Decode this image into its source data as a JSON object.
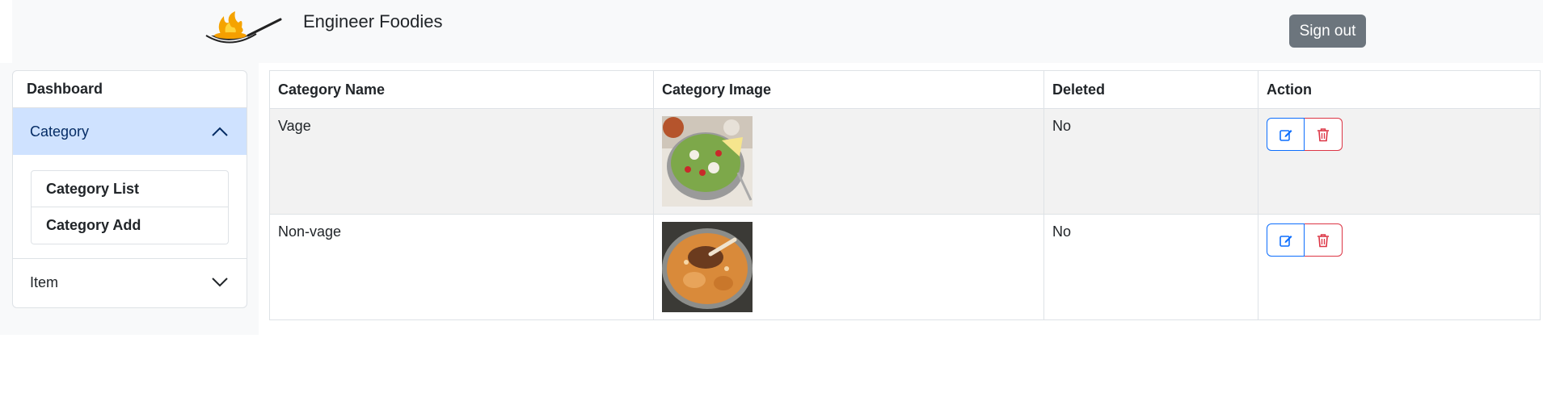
{
  "header": {
    "brand_name": "Engineer Foodies",
    "signout_label": "Sign out"
  },
  "sidebar": {
    "dashboard_label": "Dashboard",
    "sections": [
      {
        "label": "Category",
        "expanded": true,
        "items": [
          "Category List",
          "Category Add"
        ]
      },
      {
        "label": "Item",
        "expanded": false
      }
    ]
  },
  "table": {
    "columns": [
      "Category Name",
      "Category Image",
      "Deleted",
      "Action"
    ],
    "rows": [
      {
        "name": "Vage",
        "image": "salad-bowl-image",
        "deleted": "No"
      },
      {
        "name": "Non-vage",
        "image": "biryani-plate-image",
        "deleted": "No"
      }
    ]
  },
  "colors": {
    "navbar_bg": "#f8f9fa",
    "signout_bg": "#6c757d",
    "active_section_bg": "#cfe2ff",
    "edit_accent": "#0d6efd",
    "delete_accent": "#dc3545"
  }
}
